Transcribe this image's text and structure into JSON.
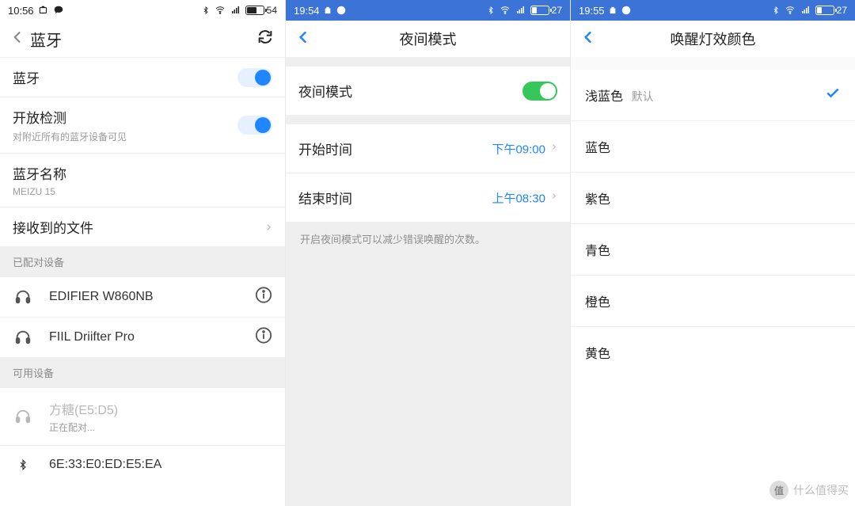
{
  "screen1": {
    "status": {
      "time": "10:56",
      "battery_pct": 54,
      "battery_text": "54"
    },
    "title": "蓝牙",
    "bluetooth_toggle_label": "蓝牙",
    "bluetooth_toggle_on": true,
    "discoverable": {
      "title": "开放检测",
      "subtitle": "对附近所有的蓝牙设备可见",
      "on": true
    },
    "device_name": {
      "label": "蓝牙名称",
      "value": "MEIZU 15"
    },
    "received_files_label": "接收到的文件",
    "sections": {
      "paired": "已配对设备",
      "available": "可用设备"
    },
    "paired_devices": [
      {
        "name": "EDIFIER W860NB",
        "icon": "headphones"
      },
      {
        "name": "FIIL Driifter Pro",
        "icon": "headphones"
      }
    ],
    "available_devices": [
      {
        "name": "方糖(E5:D5)",
        "sub": "正在配对...",
        "icon": "headphones",
        "gray": true
      },
      {
        "name": "6E:33:E0:ED:E5:EA",
        "icon": "bluetooth"
      }
    ]
  },
  "screen2": {
    "status": {
      "time": "19:54",
      "battery_pct": 27,
      "battery_text": "27"
    },
    "title": "夜间模式",
    "night_mode": {
      "label": "夜间模式",
      "on": true
    },
    "start_time": {
      "label": "开始时间",
      "value": "下午09:00"
    },
    "end_time": {
      "label": "结束时间",
      "value": "上午08:30"
    },
    "description": "开启夜间模式可以减少错误唤醒的次数。"
  },
  "screen3": {
    "status": {
      "time": "19:55",
      "battery_pct": 27,
      "battery_text": "27"
    },
    "title": "唤醒灯效颜色",
    "default_suffix": "默认",
    "options": [
      {
        "label": "浅蓝色",
        "is_default": true,
        "selected": true
      },
      {
        "label": "蓝色"
      },
      {
        "label": "紫色"
      },
      {
        "label": "青色"
      },
      {
        "label": "橙色"
      },
      {
        "label": "黄色"
      }
    ]
  },
  "watermark": "什么值得买"
}
